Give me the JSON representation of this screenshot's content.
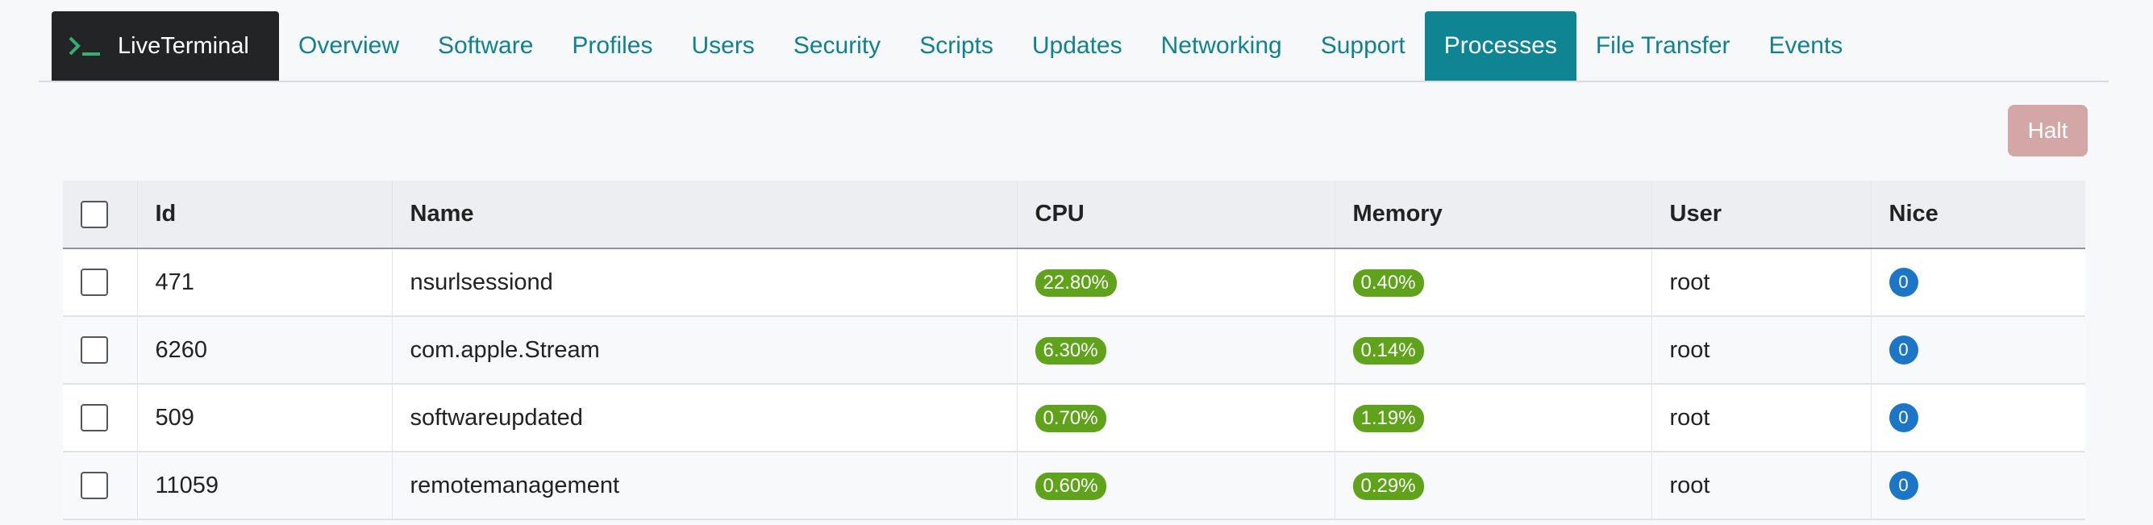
{
  "brand": {
    "name": "LiveTerminal",
    "icon": "terminal-icon"
  },
  "nav": {
    "items": [
      {
        "label": "Overview",
        "active": false
      },
      {
        "label": "Software",
        "active": false
      },
      {
        "label": "Profiles",
        "active": false
      },
      {
        "label": "Users",
        "active": false
      },
      {
        "label": "Security",
        "active": false
      },
      {
        "label": "Scripts",
        "active": false
      },
      {
        "label": "Updates",
        "active": false
      },
      {
        "label": "Networking",
        "active": false
      },
      {
        "label": "Support",
        "active": false
      },
      {
        "label": "Processes",
        "active": true
      },
      {
        "label": "File Transfer",
        "active": false
      },
      {
        "label": "Events",
        "active": false
      }
    ]
  },
  "actions": {
    "halt_label": "Halt"
  },
  "table": {
    "headers": [
      "Id",
      "Name",
      "CPU",
      "Memory",
      "User",
      "Nice"
    ],
    "rows": [
      {
        "id": "471",
        "name": "nsurlsessiond",
        "cpu": "22.80%",
        "memory": "0.40%",
        "user": "root",
        "nice": "0"
      },
      {
        "id": "6260",
        "name": "com.apple.Stream",
        "cpu": "6.30%",
        "memory": "0.14%",
        "user": "root",
        "nice": "0"
      },
      {
        "id": "509",
        "name": "softwareupdated",
        "cpu": "0.70%",
        "memory": "1.19%",
        "user": "root",
        "nice": "0"
      },
      {
        "id": "11059",
        "name": "remotemanagement",
        "cpu": "0.60%",
        "memory": "0.29%",
        "user": "root",
        "nice": "0"
      }
    ]
  },
  "colors": {
    "accent": "#0f8593",
    "link": "#0f8291",
    "badge_green": "#5fa31b",
    "badge_blue": "#1b76c8",
    "halt_disabled": "#d4a7a7",
    "brand_bg": "#222426",
    "prompt_green": "#2fb36b"
  }
}
